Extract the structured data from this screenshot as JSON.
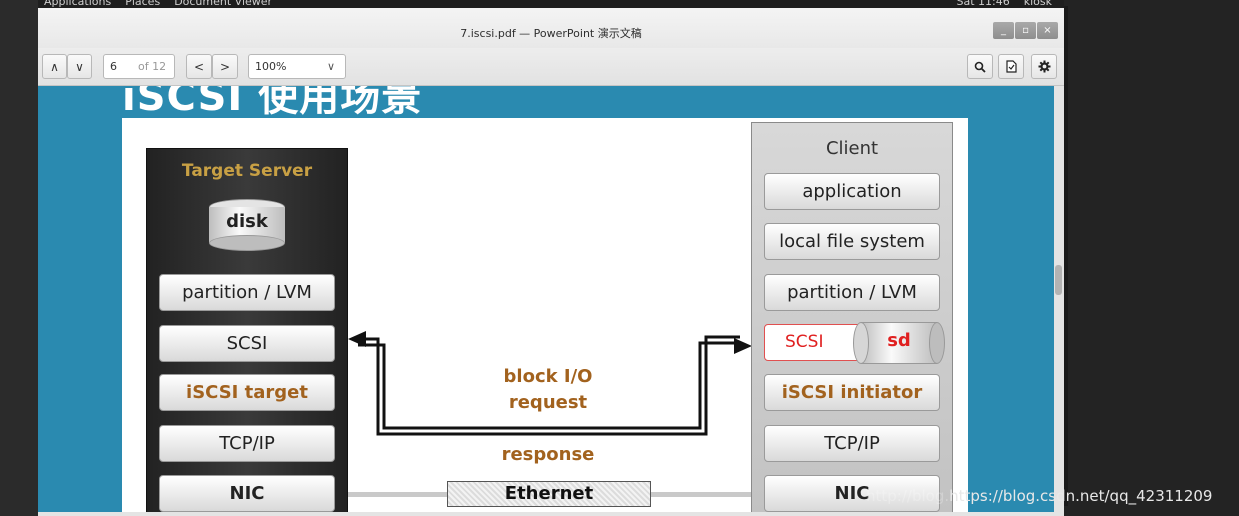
{
  "desktop": {
    "applications": "Applications",
    "places": "Places",
    "document_viewer": "Document Viewer",
    "clock": "Sat 11:46",
    "user": "kiosk"
  },
  "window": {
    "title": "7.iscsi.pdf — PowerPoint 演示文稿",
    "minimize": "_",
    "maximize": "▫",
    "close": "×"
  },
  "toolbar": {
    "page_up": "∧",
    "page_down": "∨",
    "page_value": "6",
    "page_total": "of 12",
    "back": "<",
    "forward": ">",
    "zoom": "100%",
    "zoom_dropdown": "∨",
    "search_icon": "search-icon",
    "page_icon": "document-icon",
    "gear_icon": "gear-icon"
  },
  "slide": {
    "title": "iSCSI 使用场景",
    "server": {
      "title": "Target Server",
      "disk": "disk",
      "layers": [
        "partition / LVM",
        "SCSI",
        "iSCSI target",
        "TCP/IP",
        "NIC"
      ]
    },
    "client": {
      "title": "Client",
      "layers": [
        "application",
        "local file system",
        "partition / LVM"
      ],
      "scsi": "SCSI",
      "sd": "sd",
      "layers_lower": [
        "iSCSI initiator",
        "TCP/IP",
        "NIC"
      ]
    },
    "block_io_line1": "block I/O",
    "block_io_line2": "request",
    "response": "response",
    "ethernet": "Ethernet"
  },
  "watermark": {
    "faint": "http://blog.",
    "text": "https://blog.csdn.net/qq_42311209"
  },
  "colors": {
    "slide_bg": "#2a8ab0",
    "server_title": "#c8a044",
    "brown_text": "#a2621e",
    "scsi_red": "#e02020"
  }
}
